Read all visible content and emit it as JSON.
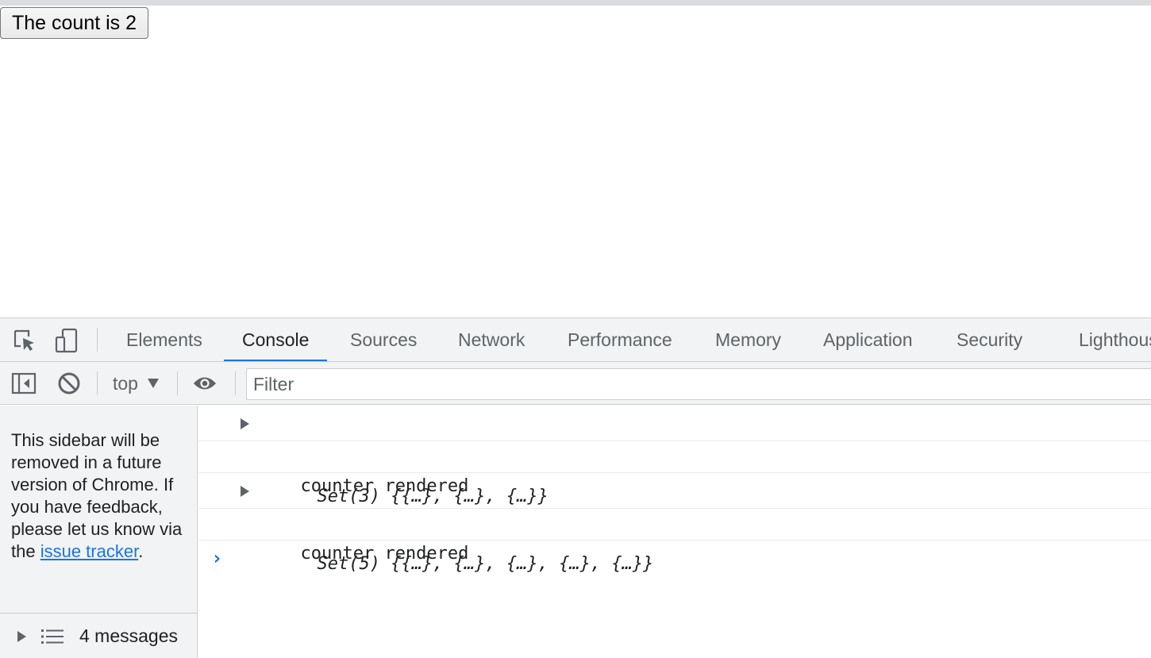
{
  "page": {
    "count_button_label": "The count is 2"
  },
  "devtools": {
    "tabs": [
      {
        "label": "Elements",
        "active": false
      },
      {
        "label": "Console",
        "active": true
      },
      {
        "label": "Sources",
        "active": false
      },
      {
        "label": "Network",
        "active": false
      },
      {
        "label": "Performance",
        "active": false
      },
      {
        "label": "Memory",
        "active": false
      },
      {
        "label": "Application",
        "active": false
      },
      {
        "label": "Security",
        "active": false
      },
      {
        "label": "Lighthouse",
        "active": false
      }
    ],
    "toolbar": {
      "context": "top",
      "filter_placeholder": "Filter"
    },
    "sidebar": {
      "note_text": "This sidebar will be removed in a future version of Chrome. If you have feedback, please let us know via the ",
      "note_link": "issue tracker",
      "note_end": ".",
      "messages_label": "4 messages"
    },
    "console": {
      "rows": [
        {
          "kind": "object",
          "text": "Set(3) {{…}, {…}, {…}}"
        },
        {
          "kind": "text",
          "text": "counter rendered"
        },
        {
          "kind": "object",
          "text": "Set(5) {{…}, {…}, {…}, {…}, {…}}"
        },
        {
          "kind": "text",
          "text": "counter rendered"
        }
      ],
      "prompt_symbol": "›"
    },
    "colors": {
      "accent": "#1a73e8",
      "panel_bg": "#f1f3f4",
      "border": "#cbcdd1"
    },
    "icons": {
      "inspect": "inspect-element-icon",
      "device": "device-toolbar-icon",
      "sidebar": "show-sidebar-icon",
      "clear": "clear-console-icon",
      "eye": "live-expression-icon",
      "list": "message-list-icon"
    }
  }
}
